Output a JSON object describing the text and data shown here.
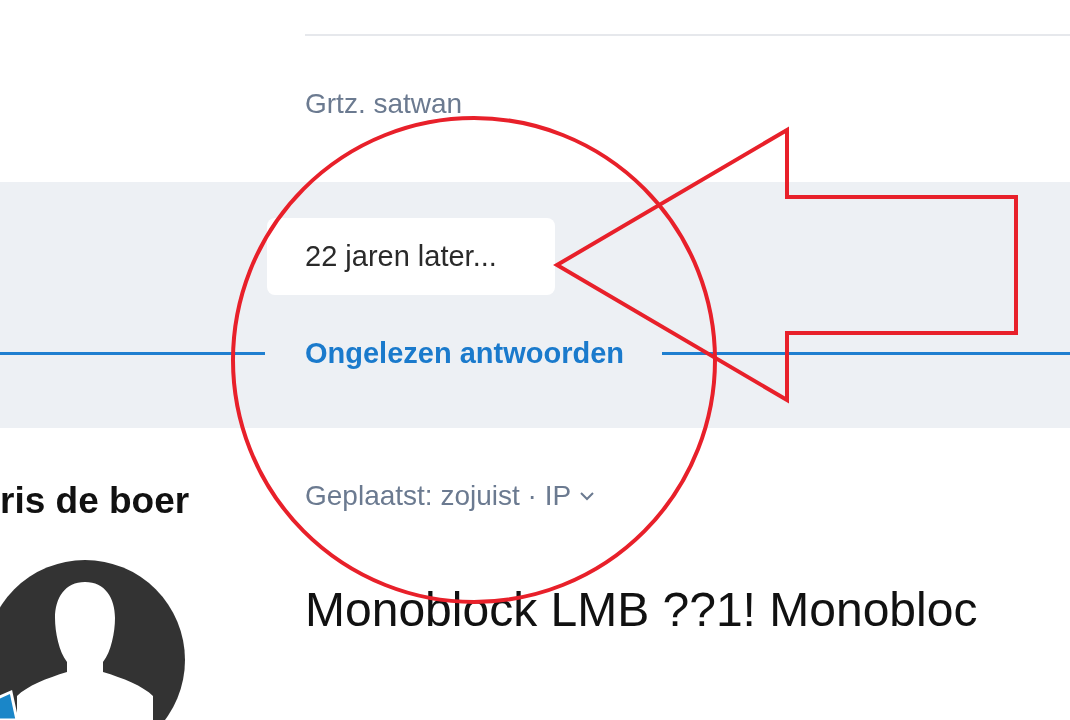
{
  "previous_post": {
    "signature": "Grtz. satwan"
  },
  "gap_notice": {
    "label": "22 jaren later...",
    "divider_label": "Ongelezen antwoorden"
  },
  "post": {
    "author": "ris de boer",
    "meta": "Geplaatst: zojuist · IP",
    "meta_expandable": true,
    "title": "Monoblock LMB ??1!  Monobloc"
  }
}
